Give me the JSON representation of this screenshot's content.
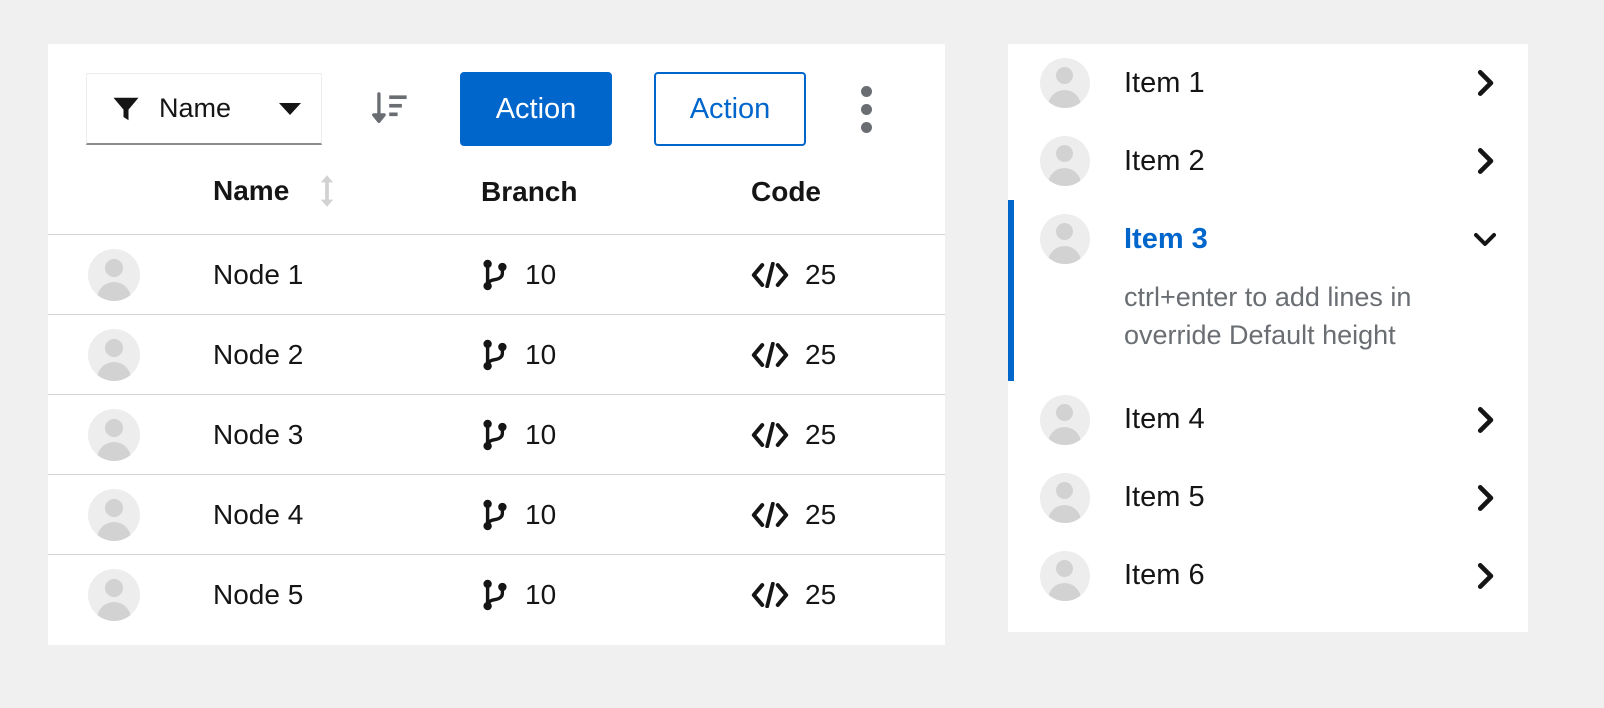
{
  "theme": {
    "page_background": "#f0f0f0",
    "card_background": "#ffffff",
    "accent_blue": "#0066cc",
    "text_primary": "#151515",
    "text_muted": "#6a6e73",
    "border": "#d2d2d2"
  },
  "table_card": {
    "toolbar": {
      "filter": {
        "icon": "filter-icon",
        "value": "Name",
        "caret": "chevron-down-icon"
      },
      "sort_button": {
        "icon": "sort-amount-down-icon"
      },
      "primary_action": {
        "label": "Action"
      },
      "secondary_action": {
        "label": "Action"
      },
      "kebab_button": {
        "icon": "ellipsis-vertical-icon"
      }
    },
    "columns": [
      {
        "key": "avatar",
        "label": ""
      },
      {
        "key": "name",
        "label": "Name",
        "sortable": true,
        "sort_icon": "sort-arrows-icon"
      },
      {
        "key": "branch",
        "label": "Branch"
      },
      {
        "key": "code",
        "label": "Code"
      }
    ],
    "rows": [
      {
        "avatar": "avatar-icon",
        "name": "Node 1",
        "branch_icon": "code-branch-icon",
        "branch": "10",
        "code_icon": "code-icon",
        "code": "25"
      },
      {
        "avatar": "avatar-icon",
        "name": "Node 2",
        "branch_icon": "code-branch-icon",
        "branch": "10",
        "code_icon": "code-icon",
        "code": "25"
      },
      {
        "avatar": "avatar-icon",
        "name": "Node 3",
        "branch_icon": "code-branch-icon",
        "branch": "10",
        "code_icon": "code-icon",
        "code": "25"
      },
      {
        "avatar": "avatar-icon",
        "name": "Node 4",
        "branch_icon": "code-branch-icon",
        "branch": "10",
        "code_icon": "code-icon",
        "code": "25"
      },
      {
        "avatar": "avatar-icon",
        "name": "Node 5",
        "branch_icon": "code-branch-icon",
        "branch": "10",
        "code_icon": "code-icon",
        "code": "25"
      }
    ]
  },
  "list_card": {
    "items": [
      {
        "label": "Item 1",
        "avatar": "avatar-icon",
        "chevron": "chevron-right-icon",
        "expanded": false,
        "active": false
      },
      {
        "label": "Item 2",
        "avatar": "avatar-icon",
        "chevron": "chevron-right-icon",
        "expanded": false,
        "active": false
      },
      {
        "label": "Item 3",
        "avatar": "avatar-icon",
        "chevron": "chevron-down-icon",
        "expanded": true,
        "active": true,
        "description": "ctrl+enter to add lines in override Default height"
      },
      {
        "label": "Item 4",
        "avatar": "avatar-icon",
        "chevron": "chevron-right-icon",
        "expanded": false,
        "active": false
      },
      {
        "label": "Item 5",
        "avatar": "avatar-icon",
        "chevron": "chevron-right-icon",
        "expanded": false,
        "active": false
      },
      {
        "label": "Item 6",
        "avatar": "avatar-icon",
        "chevron": "chevron-right-icon",
        "expanded": false,
        "active": false
      }
    ]
  }
}
